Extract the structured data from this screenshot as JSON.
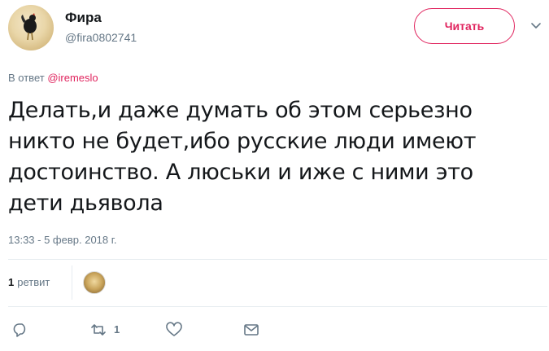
{
  "user": {
    "name": "Фира",
    "handle": "@fira0802741"
  },
  "follow_button": "Читать",
  "reply": {
    "prefix": "В ответ",
    "target": "@iremeslo"
  },
  "tweet": {
    "text": "Делать,и даже думать об этом серьезно никто не будет,ибо русские люди имеют достоинство. А люськи и иже с ними это дети дьявола",
    "timestamp": "13:33 - 5 февр. 2018 г."
  },
  "stats": {
    "retweet_count": "1",
    "retweet_label": "ретвит"
  },
  "actions": {
    "retweet_count": "1"
  },
  "colors": {
    "accent": "#e0245e",
    "muted": "#657786",
    "text": "#14171a",
    "divider": "#e6ecf0"
  },
  "icons": [
    "reply-icon",
    "retweet-icon",
    "like-icon",
    "message-icon",
    "chevron-down-icon"
  ]
}
